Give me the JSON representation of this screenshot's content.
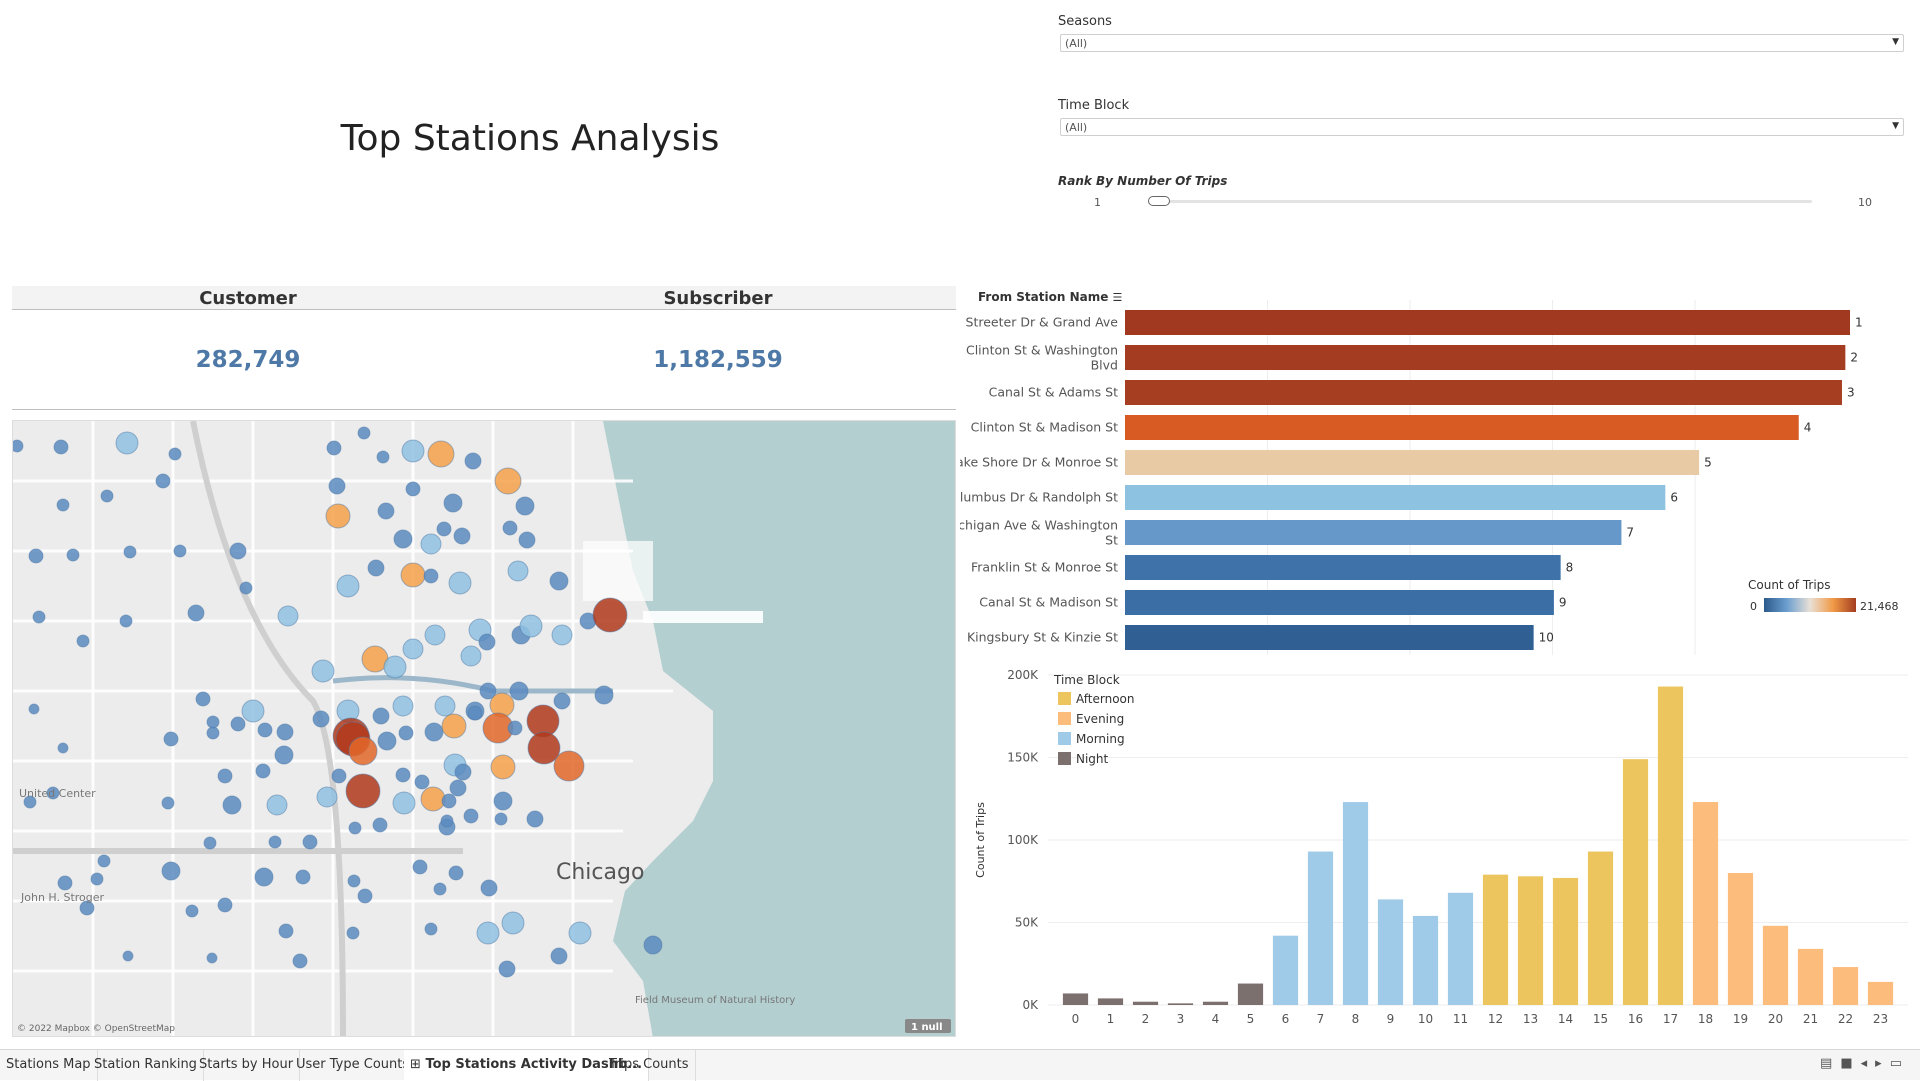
{
  "title": "Top Stations Analysis",
  "filters": {
    "seasons": {
      "label": "Seasons",
      "value": "(All)"
    },
    "time_block": {
      "label": "Time Block",
      "value": "(All)"
    },
    "rank": {
      "label": "Rank By Number Of Trips",
      "min": "1",
      "max": "10"
    }
  },
  "kpis": [
    {
      "label": "Customer",
      "value": "282,749"
    },
    {
      "label": "Subscriber",
      "value": "1,182,559"
    }
  ],
  "map": {
    "attribution": "© 2022 Mapbox © OpenStreetMap",
    "null_badge": "1 null",
    "labels": [
      "Chicago",
      "United Center",
      "John H. Stroger",
      "Field Museum of Natural History"
    ]
  },
  "station_chart": {
    "header": "From Station Name",
    "legend_title": "Count of Trips",
    "legend_min": "0",
    "legend_max": "21,468"
  },
  "chart_data": [
    {
      "type": "bar",
      "orientation": "horizontal",
      "categories": [
        "Streeter Dr & Grand Ave",
        "Clinton St & Washington Blvd",
        "Canal St & Adams St",
        "Clinton St & Madison St",
        "Lake Shore Dr & Monroe St",
        "Columbus Dr & Randolph St",
        "Michigan Ave & Washington St",
        "Franklin St & Monroe St",
        "Canal St & Madison St",
        "Kingsbury St & Kinzie St"
      ],
      "values": [
        21468,
        21330,
        21230,
        19950,
        17000,
        16000,
        14700,
        12900,
        12700,
        12100
      ],
      "rank_labels": [
        "1",
        "2",
        "3",
        "4",
        "5",
        "6",
        "7",
        "8",
        "9",
        "10"
      ],
      "colors": [
        "#a0391f",
        "#a33c20",
        "#a63e21",
        "#d95b24",
        "#e8cba5",
        "#8ec2e1",
        "#6699c9",
        "#3e72a8",
        "#3b6ea4",
        "#305f94"
      ]
    },
    {
      "type": "bar",
      "categories": [
        "0",
        "1",
        "2",
        "3",
        "4",
        "5",
        "6",
        "7",
        "8",
        "9",
        "10",
        "11",
        "12",
        "13",
        "14",
        "15",
        "16",
        "17",
        "18",
        "19",
        "20",
        "21",
        "22",
        "23"
      ],
      "values": [
        7000,
        4000,
        2000,
        1000,
        2000,
        13000,
        42000,
        93000,
        123000,
        64000,
        54000,
        68000,
        79000,
        78000,
        77000,
        93000,
        149000,
        193000,
        123000,
        80000,
        48000,
        34000,
        23000,
        14000
      ],
      "series_by_bar": [
        "Night",
        "Night",
        "Night",
        "Night",
        "Night",
        "Night",
        "Morning",
        "Morning",
        "Morning",
        "Morning",
        "Morning",
        "Morning",
        "Afternoon",
        "Afternoon",
        "Afternoon",
        "Afternoon",
        "Afternoon",
        "Afternoon",
        "Evening",
        "Evening",
        "Evening",
        "Evening",
        "Evening",
        "Evening"
      ],
      "legend_title": "Time Block",
      "legend": [
        {
          "name": "Afternoon",
          "color": "#ecc55e"
        },
        {
          "name": "Evening",
          "color": "#fcbc7c"
        },
        {
          "name": "Morning",
          "color": "#a0cbe8"
        },
        {
          "name": "Night",
          "color": "#7b706d"
        }
      ],
      "ylabel": "Count of Trips",
      "yticks": [
        "0K",
        "50K",
        "100K",
        "150K",
        "200K"
      ],
      "ylim": [
        0,
        200000
      ]
    }
  ],
  "tabs": [
    {
      "label": "Stations Map"
    },
    {
      "label": "Station Ranking"
    },
    {
      "label": "Starts by Hour"
    },
    {
      "label": "User Type Counts"
    },
    {
      "label": "Top Stations Activity Dashb..."
    },
    {
      "label": "Trips Counts"
    }
  ]
}
